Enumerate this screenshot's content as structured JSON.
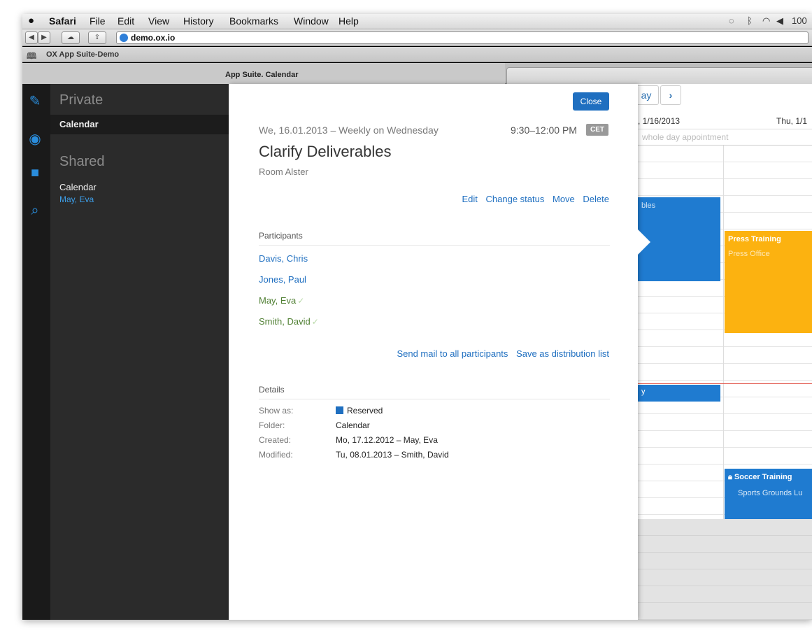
{
  "menubar": {
    "apple": "",
    "items": [
      "Safari",
      "File",
      "Edit",
      "View",
      "History",
      "Bookmarks",
      "Window",
      "Help"
    ],
    "battery": "100"
  },
  "toolbar": {
    "url": "demo.ox.io"
  },
  "bookmarks": {
    "item": "OX App Suite-Demo"
  },
  "tab": {
    "title": "App Suite. Calendar"
  },
  "sidebar": {
    "private_heading": "Private",
    "private_items": [
      "Calendar"
    ],
    "shared_heading": "Shared",
    "shared_items": [
      "Calendar",
      "May, Eva"
    ]
  },
  "calendar": {
    "today_label": "ay",
    "next_label": "›",
    "col1_header": ", 1/16/2013",
    "col2_header": "Thu, 1/1",
    "allday_placeholder": "whole day appointment",
    "events": [
      {
        "title": "bles",
        "location": ""
      },
      {
        "title": "Press Training",
        "location": "Press Office"
      },
      {
        "title": "y",
        "location": ""
      },
      {
        "title": "Soccer Training",
        "location": "Sports Grounds Lu"
      }
    ],
    "colors": {
      "blue": "#1f7bd0",
      "orange": "#fcb210"
    }
  },
  "detail": {
    "close_label": "Close",
    "date": "We, 16.01.2013 – Weekly on Wednesday",
    "time": "9:30–12:00 PM",
    "timezone": "CET",
    "title": "Clarify Deliverables",
    "location": "Room Alster",
    "actions": [
      "Edit",
      "Change status",
      "Move",
      "Delete"
    ],
    "participants_heading": "Participants",
    "participants": [
      {
        "name": "Davis, Chris",
        "accepted": false
      },
      {
        "name": "Jones, Paul",
        "accepted": false
      },
      {
        "name": "May, Eva",
        "accepted": true
      },
      {
        "name": "Smith, David",
        "accepted": true
      }
    ],
    "participant_actions": [
      "Send mail to all participants",
      "Save as distribution list"
    ],
    "details_heading": "Details",
    "details": [
      {
        "label": "Show as:",
        "value": "Reserved"
      },
      {
        "label": "Folder:",
        "value": "Calendar"
      },
      {
        "label": "Created:",
        "value": "Mo, 17.12.2012 – May, Eva"
      },
      {
        "label": "Modified:",
        "value": "Tu, 08.01.2013 – Smith, David"
      }
    ],
    "accent": "#1f6fc0"
  }
}
